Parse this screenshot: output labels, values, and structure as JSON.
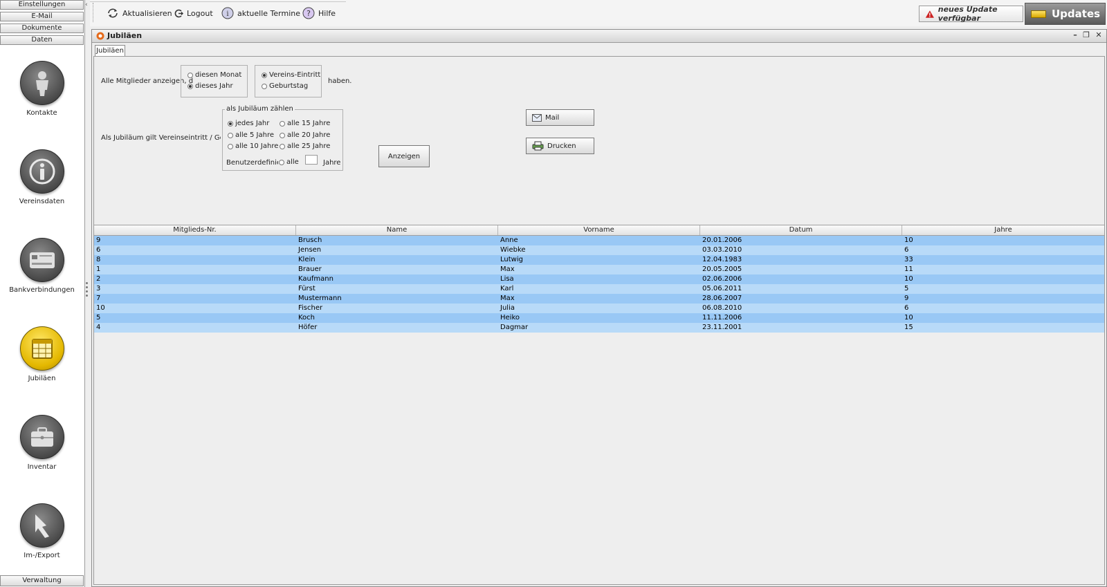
{
  "sidebar": {
    "accordion": [
      "Einstellungen",
      "E-Mail",
      "Dokumente",
      "Daten"
    ],
    "bottom": "Verwaltung",
    "items": [
      {
        "label": "Kontakte",
        "icon": "person-icon"
      },
      {
        "label": "Vereinsdaten",
        "icon": "info-icon"
      },
      {
        "label": "Bankverbindungen",
        "icon": "credit-card-icon"
      },
      {
        "label": "Jubiläen",
        "icon": "calendar-icon"
      },
      {
        "label": "Inventar",
        "icon": "briefcase-icon"
      },
      {
        "label": "Im-/Export",
        "icon": "export-arrow-icon"
      }
    ],
    "active_item": "Jubiläen"
  },
  "toolbar": {
    "refresh": "Aktualisieren",
    "logout": "Logout",
    "appointments": "aktuelle Termine",
    "help": "Hilfe",
    "update_notice": "neues Update verfügbar",
    "updates": "Updates"
  },
  "window": {
    "title": "Jubiläen",
    "tab": "Jubiläen"
  },
  "form": {
    "show_members_prefix": "Alle Mitglieder anzeigen, d",
    "have_suffix": "haben.",
    "period": {
      "options": [
        "diesen Monat",
        "dieses Jahr"
      ],
      "selected": "dieses Jahr"
    },
    "event": {
      "options": [
        "Vereins-Eintritt",
        "Geburtstag"
      ],
      "selected": "Vereins-Eintritt"
    },
    "jubilee_rule_text": "Als Jubiläum gilt Vereinseintritt / Gebur",
    "count_group": {
      "legend": "als Jubiläum zählen",
      "options": [
        "jedes Jahr",
        "alle 15 Jahre",
        "alle 5 Jahre",
        "alle 20 Jahre",
        "alle 10 Jahre",
        "alle 25 Jahre"
      ],
      "selected": "jedes Jahr",
      "custom_label": "Benutzerdefiniert",
      "custom_option": "alle",
      "custom_value": "",
      "custom_unit": "Jahre"
    },
    "show_button": "Anzeigen",
    "mail_button": "Mail",
    "print_button": "Drucken"
  },
  "table": {
    "columns": [
      "Mitglieds-Nr.",
      "Name",
      "Vorname",
      "Datum",
      "Jahre"
    ],
    "rows": [
      [
        "9",
        "Brusch",
        "Anne",
        "20.01.2006",
        "10"
      ],
      [
        "6",
        "Jensen",
        "Wiebke",
        "03.03.2010",
        "6"
      ],
      [
        "8",
        "Klein",
        "Lutwig",
        "12.04.1983",
        "33"
      ],
      [
        "1",
        "Brauer",
        "Max",
        "20.05.2005",
        "11"
      ],
      [
        "2",
        "Kaufmann",
        "Lisa",
        "02.06.2006",
        "10"
      ],
      [
        "3",
        "Fürst",
        "Karl",
        "05.06.2011",
        "5"
      ],
      [
        "7",
        "Mustermann",
        "Max",
        "28.06.2007",
        "9"
      ],
      [
        "10",
        "Fischer",
        "Julia",
        "06.08.2010",
        "6"
      ],
      [
        "5",
        "Koch",
        "Heiko",
        "11.11.2006",
        "10"
      ],
      [
        "4",
        "Höfer",
        "Dagmar",
        "23.11.2001",
        "15"
      ]
    ]
  },
  "colors": {
    "row_dark": "#99c8f5",
    "row_light": "#b8daf8",
    "active_nav": "#e4b800",
    "nav_icon": "#4a4a4a",
    "warning": "#cc2222"
  }
}
